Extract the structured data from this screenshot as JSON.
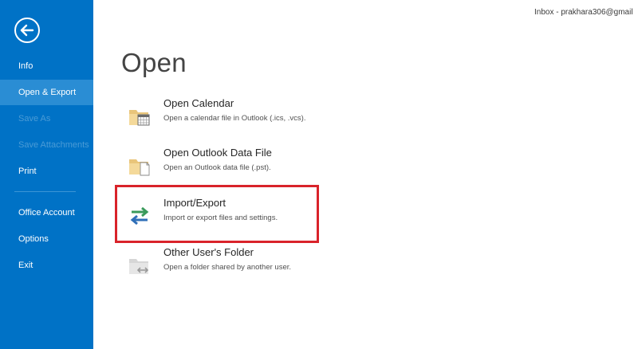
{
  "sidebar": {
    "back_icon": "back-arrow-circle-icon",
    "items": [
      {
        "label": "Info"
      },
      {
        "label": "Open & Export"
      },
      {
        "label": "Save As"
      },
      {
        "label": "Save Attachments"
      },
      {
        "label": "Print"
      },
      {
        "label": "Office Account"
      },
      {
        "label": "Options"
      },
      {
        "label": "Exit"
      }
    ],
    "active_index": 1
  },
  "header": {
    "account": "Inbox - prakhara306@gmail"
  },
  "main": {
    "title": "Open",
    "options": [
      {
        "title": "Open Calendar",
        "description": "Open a calendar file in Outlook (.ics, .vcs).",
        "icon": "folder-calendar-icon"
      },
      {
        "title": "Open Outlook Data File",
        "description": "Open an Outlook data file (.pst).",
        "icon": "folder-data-file-icon"
      },
      {
        "title": "Import/Export",
        "description": "Import or export files and settings.",
        "icon": "import-export-arrows-icon"
      },
      {
        "title": "Other User's Folder",
        "description": "Open a folder shared by another user.",
        "icon": "shared-folder-icon"
      }
    ]
  },
  "colors": {
    "sidebar": "#0072c6",
    "sidebar_active": "#2a8dd4",
    "highlight": "#d9232a"
  }
}
